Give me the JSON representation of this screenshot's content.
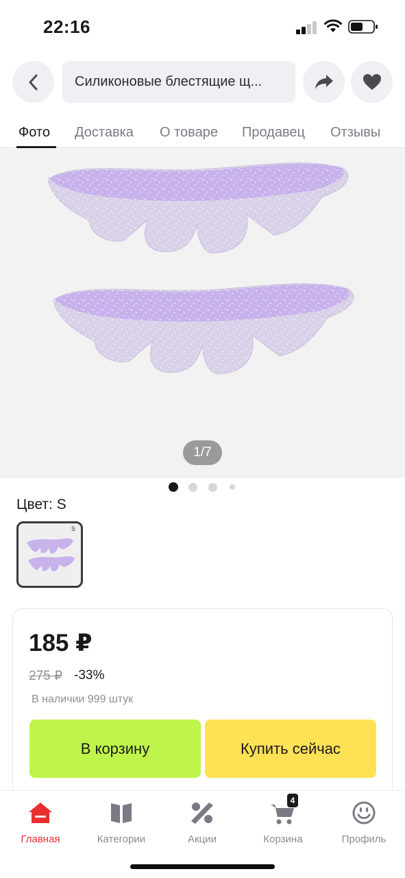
{
  "status_bar": {
    "time": "22:16"
  },
  "header": {
    "back_icon": "chevron-left-icon",
    "search_text": "Силиконовые блестящие щ...",
    "share_icon": "share-arrow-icon",
    "favorite_icon": "heart-icon"
  },
  "tabs": [
    {
      "label": "Фото",
      "active": true
    },
    {
      "label": "Доставка",
      "active": false
    },
    {
      "label": "О товаре",
      "active": false
    },
    {
      "label": "Продавец",
      "active": false
    },
    {
      "label": "Отзывы",
      "active": false
    }
  ],
  "gallery": {
    "counter": "1/7",
    "current_index": 1,
    "total": 7
  },
  "color": {
    "label": "Цвет: S",
    "swatch_size": "S"
  },
  "price": {
    "current": "185 ₽",
    "old": "275 ₽",
    "discount": "-33%",
    "stock": "В наличии 999 штук"
  },
  "actions": {
    "cart": "В корзину",
    "buy": "Купить сейчас"
  },
  "bottom_nav": [
    {
      "label": "Главная",
      "icon": "home-icon",
      "active": true
    },
    {
      "label": "Категории",
      "icon": "book-icon",
      "active": false
    },
    {
      "label": "Акции",
      "icon": "percent-icon",
      "active": false
    },
    {
      "label": "Корзина",
      "icon": "cart-icon",
      "active": false,
      "badge": "4"
    },
    {
      "label": "Профиль",
      "icon": "smiley-icon",
      "active": false
    }
  ],
  "colors": {
    "accent_red": "#e8302f",
    "cart_button": "#bff54a",
    "buy_button": "#ffe156",
    "product_lilac": "#c7b2ec"
  }
}
